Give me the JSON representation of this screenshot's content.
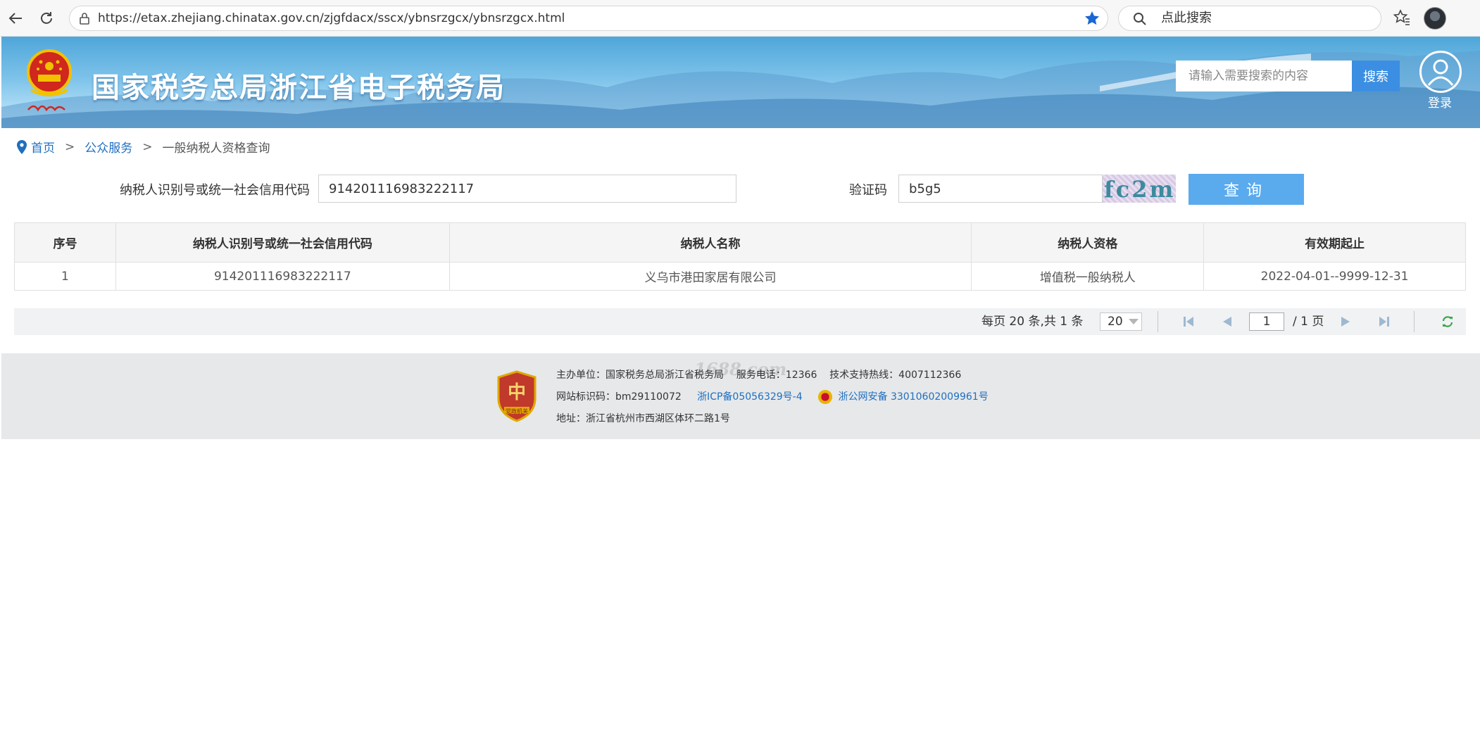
{
  "browser": {
    "url": "https://etax.zhejiang.chinatax.gov.cn/zjgfdacx/sscx/ybnsrzgcx/ybnsrzgcx.html",
    "search_placeholder": "点此搜索"
  },
  "header": {
    "site_title": "国家税务总局浙江省电子税务局",
    "search_placeholder": "请输入需要搜索的内容",
    "search_button": "搜索",
    "login_label": "登录"
  },
  "breadcrumb": {
    "home": "首页",
    "separator": ">",
    "public_service": "公众服务",
    "current": "一般纳税人资格查询"
  },
  "form": {
    "tax_id_label": "纳税人识别号或统一社会信用代码",
    "tax_id_value": "914201116983222117",
    "captcha_label": "验证码",
    "captcha_value": "b5g5",
    "captcha_image_text": "fc2m",
    "query_button": "查询"
  },
  "table": {
    "headers": [
      "序号",
      "纳税人识别号或统一社会信用代码",
      "纳税人名称",
      "纳税人资格",
      "有效期起止"
    ],
    "rows": [
      [
        "1",
        "914201116983222117",
        "义乌市港田家居有限公司",
        "增值税一般纳税人",
        "2022-04-01--9999-12-31"
      ]
    ]
  },
  "pagination": {
    "info": "每页 20 条,共 1 条",
    "page_size": "20",
    "current_page": "1",
    "total_pages": "/ 1 页"
  },
  "footer": {
    "sponsor": "主办单位：国家税务总局浙江省税务局",
    "phone": "服务电话：12366",
    "support": "技术支持热线：4007112366",
    "site_id": "网站标识码：bm29110072",
    "icp": "浙ICP备05056329号-4",
    "police_record": "浙公网安备 33010602009961号",
    "address": "地址：浙江省杭州市西湖区体环二路1号",
    "watermark": "1688.com",
    "badge_text": "党政机关"
  },
  "colors": {
    "accent": "#5aaaee",
    "link": "#1f6fbf",
    "search_button": "#3b8ee2"
  }
}
